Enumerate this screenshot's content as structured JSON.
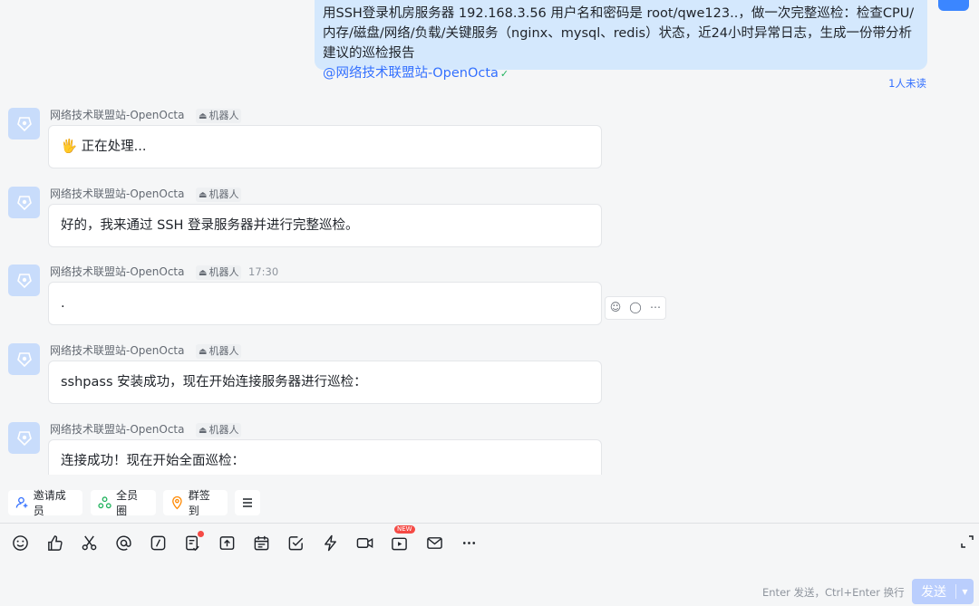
{
  "self_message": {
    "text": "用SSH登录机房服务器 192.168.3.56 用户名和密码是 root/qwe123..，做一次完整巡检：检查CPU/内存/磁盘/网络/负载/关键服务（nginx、mysql、redis）状态，近24小时异常日志，生成一份带分析建议的巡检报告",
    "mention": "@网络技术联盟站-OpenOcta",
    "read_status": "1人未读"
  },
  "messages": [
    {
      "sender": "网络技术联盟站-OpenOcta",
      "badge": "机器人",
      "time": "",
      "content": "🖐 正在处理..."
    },
    {
      "sender": "网络技术联盟站-OpenOcta",
      "badge": "机器人",
      "time": "",
      "content": "好的，我来通过 SSH 登录服务器并进行完整巡检。"
    },
    {
      "sender": "网络技术联盟站-OpenOcta",
      "badge": "机器人",
      "time": "17:30",
      "content": "."
    },
    {
      "sender": "网络技术联盟站-OpenOcta",
      "badge": "机器人",
      "time": "",
      "content": "sshpass 安装成功，现在开始连接服务器进行巡检："
    },
    {
      "sender": "网络技术联盟站-OpenOcta",
      "badge": "机器人",
      "time": "",
      "content": "连接成功！现在开始全面巡检："
    }
  ],
  "quick_actions": {
    "invite": "邀请成员",
    "all_members": "全员圈",
    "checkin": "群签到"
  },
  "toolbar": {
    "new_badge": "NEW"
  },
  "input": {
    "hint": "Enter 发送，Ctrl+Enter 换行",
    "send_label": "发送"
  },
  "colors": {
    "accent": "#3370ff",
    "self_bubble": "#d4e8fd",
    "send_disabled": "#bacefd"
  }
}
